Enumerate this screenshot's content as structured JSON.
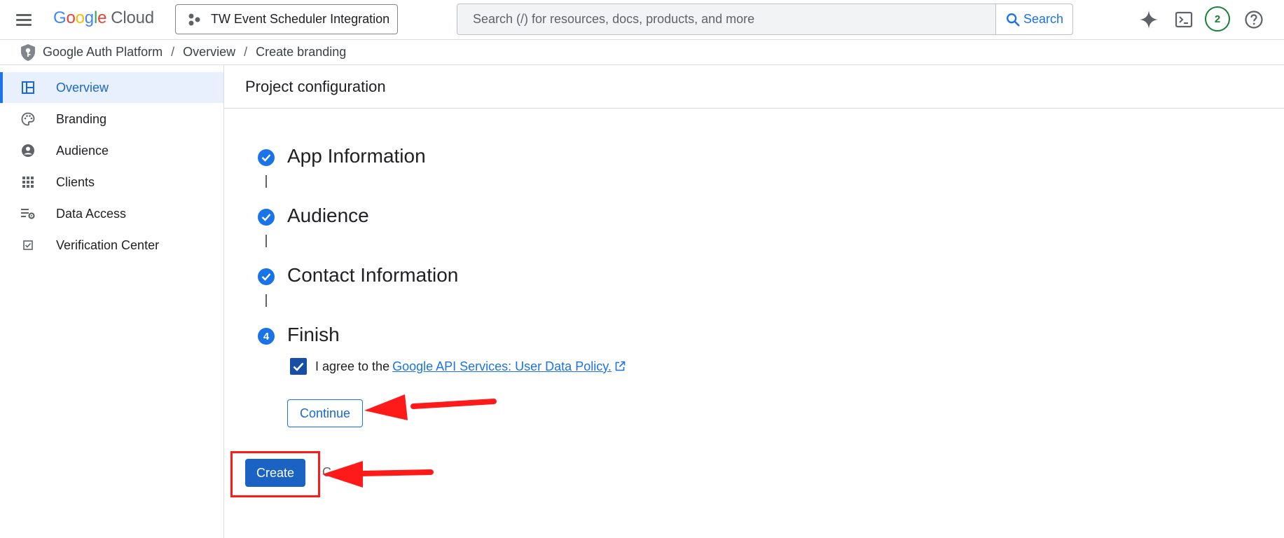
{
  "topbar": {
    "logo_letters": [
      "G",
      "o",
      "o",
      "g",
      "l",
      "e"
    ],
    "logo_cloud": "Cloud",
    "project_name": "TW Event Scheduler Integration",
    "search_placeholder": "Search (/) for resources, docs, products, and more",
    "search_value": "",
    "search_button_label": "Search",
    "notifications_count": "2",
    "icons": [
      "menu-icon",
      "project-icon",
      "search-icon",
      "gemini-sparkle-icon",
      "cloud-shell-icon",
      "help-icon"
    ]
  },
  "breadcrumb": {
    "items": [
      "Google Auth Platform",
      "Overview",
      "Create branding"
    ],
    "separator": "/"
  },
  "sidebar": {
    "items": [
      {
        "label": "Overview",
        "icon": "dashboard-icon",
        "active": true
      },
      {
        "label": "Branding",
        "icon": "palette-icon",
        "active": false
      },
      {
        "label": "Audience",
        "icon": "account-circle-icon",
        "active": false
      },
      {
        "label": "Clients",
        "icon": "apps-grid-icon",
        "active": false
      },
      {
        "label": "Data Access",
        "icon": "list-settings-icon",
        "active": false
      },
      {
        "label": "Verification Center",
        "icon": "checkbox-icon",
        "active": false
      }
    ]
  },
  "main": {
    "title": "Project configuration",
    "steps": [
      {
        "title": "App Information",
        "state": "complete"
      },
      {
        "title": "Audience",
        "state": "complete"
      },
      {
        "title": "Contact Information",
        "state": "complete"
      },
      {
        "title": "Finish",
        "state": "current",
        "number": "4"
      }
    ],
    "agree_text": "I agree to the",
    "policy_link": "Google API Services: User Data Policy.",
    "agree_checked": true,
    "continue_label": "Continue",
    "create_label": "Create",
    "obscured_label": "C"
  },
  "colors": {
    "accent": "#1a73e8",
    "create_button": "#1a62c4",
    "checkbox": "#174ea6",
    "annotation_red": "#ff1a1a",
    "notification_green": "#188038"
  }
}
